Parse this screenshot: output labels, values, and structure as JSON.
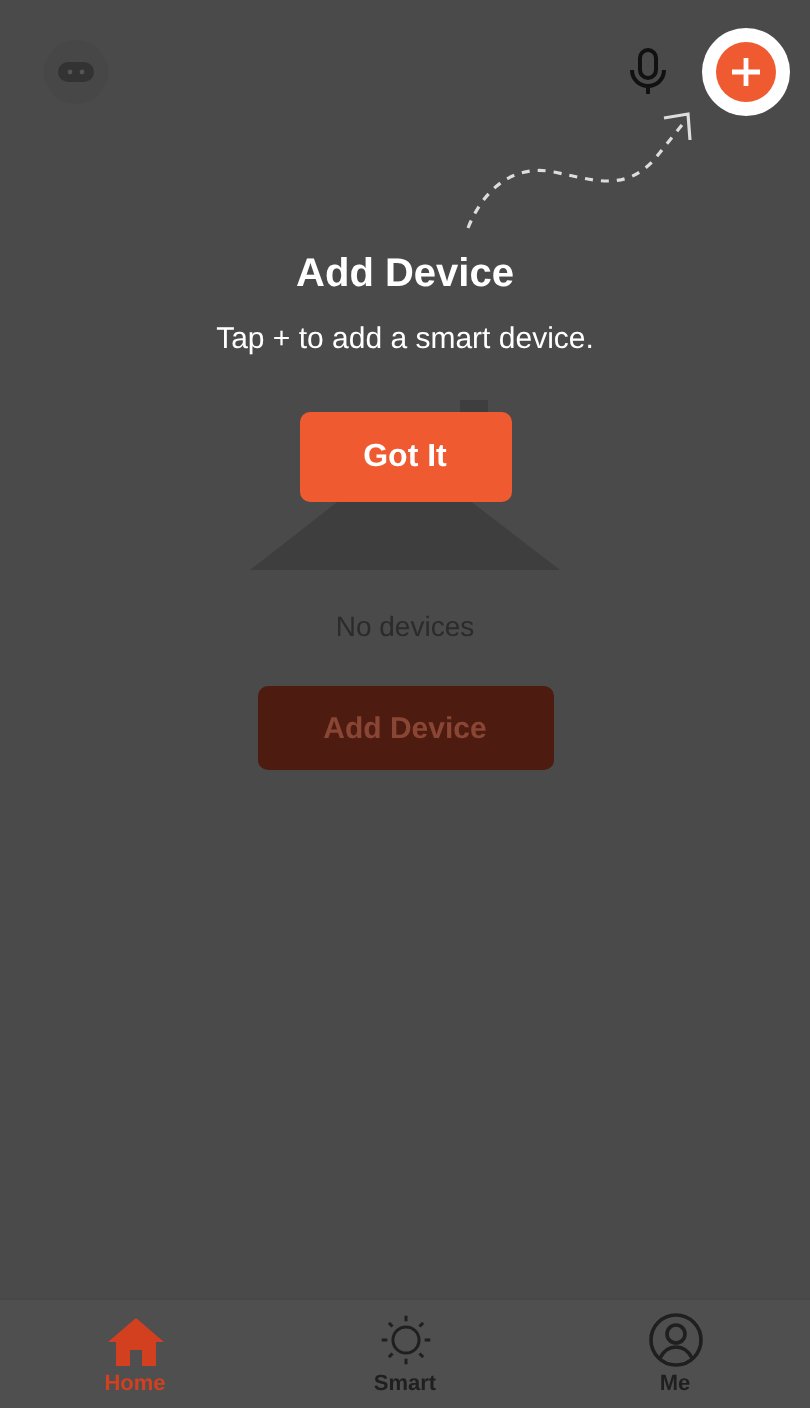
{
  "coach_mark": {
    "title": "Add Device",
    "message": "Tap + to add a smart device.",
    "button": "Got It"
  },
  "empty_state": {
    "message": "No devices",
    "button": "Add Device"
  },
  "tabs": [
    {
      "kind": "home",
      "label": "Home",
      "selected": true
    },
    {
      "kind": "smart",
      "label": "Smart",
      "selected": false
    },
    {
      "kind": "me",
      "label": "Me",
      "selected": false
    }
  ]
}
